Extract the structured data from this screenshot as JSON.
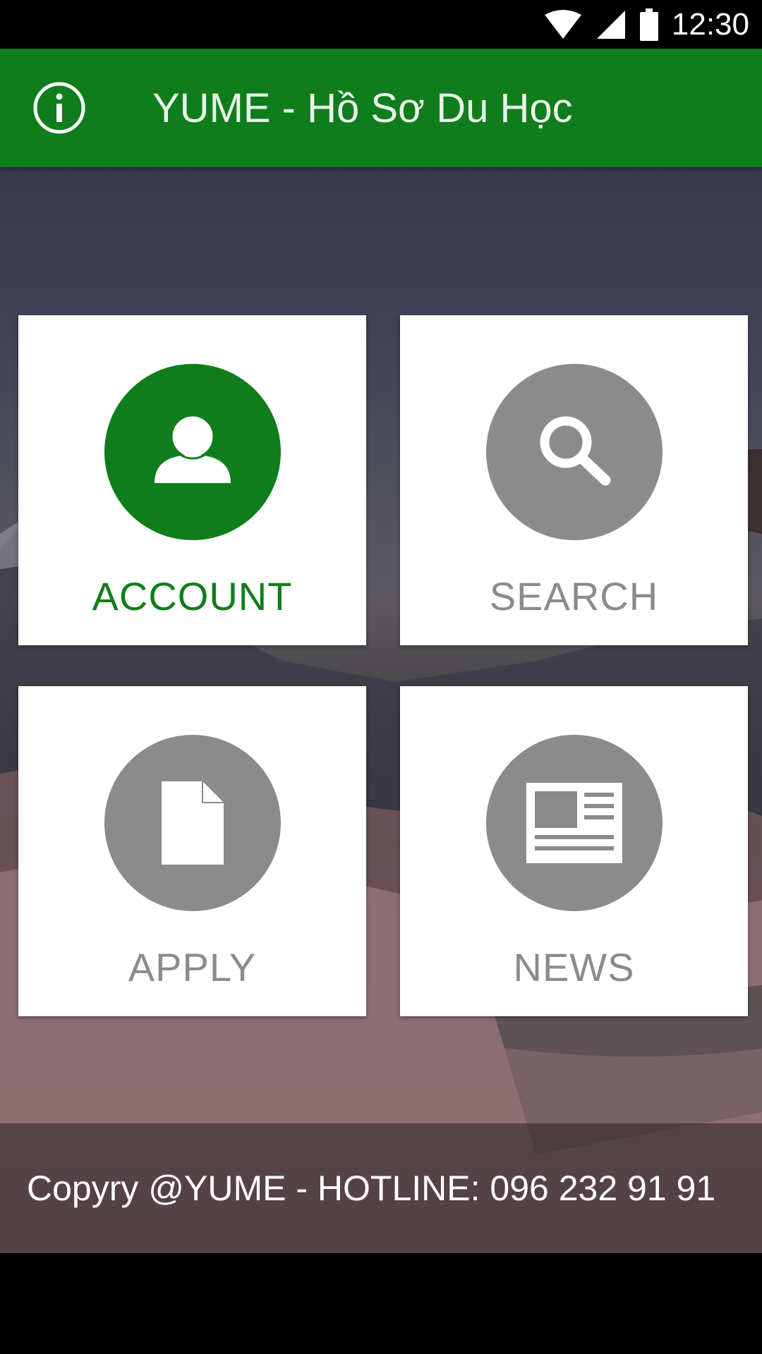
{
  "status_bar": {
    "time": "12:30",
    "icons": [
      "wifi-icon",
      "cell-signal-icon",
      "battery-icon"
    ]
  },
  "app_bar": {
    "title": "YUME - Hồ Sơ Du Học",
    "info_icon": "info-icon",
    "background_color": "#0f7d1b"
  },
  "menu": {
    "tiles": [
      {
        "label": "ACCOUNT",
        "icon": "person-icon",
        "active": true
      },
      {
        "label": "SEARCH",
        "icon": "search-icon",
        "active": false
      },
      {
        "label": "APPLY",
        "icon": "document-icon",
        "active": false
      },
      {
        "label": "NEWS",
        "icon": "newspaper-icon",
        "active": false
      }
    ],
    "active_color": "#0f7d1b",
    "inactive_color": "#8b8b8b"
  },
  "footer": {
    "text": "Copyry @YUME - HOTLINE: 096 232 91 91"
  }
}
